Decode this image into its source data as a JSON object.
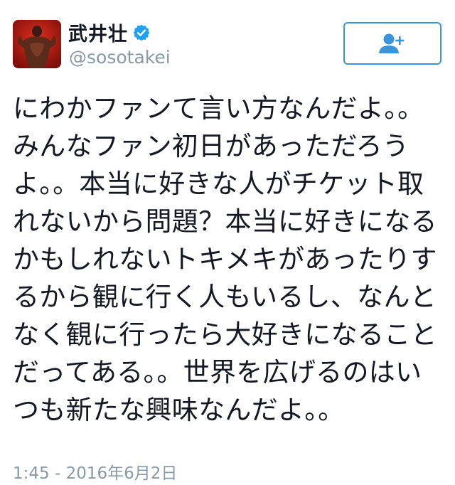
{
  "user": {
    "display_name": "武井壮",
    "handle": "@sosotakei",
    "verified": true
  },
  "follow_button": {
    "icon": "add-user-icon",
    "color": "#3b94d9"
  },
  "tweet": {
    "text": "にわかファンて言い方なんだよ。。\nみんなファン初日があっただろう\nよ。。本当に好きな人がチケット取\nれないから問題？本当に好きになる\nかもしれないトキメキがあったりす\nるから観に行く人もいるし、なんと\nなく観に行ったら大好きになること\nだってある。。世界を広げるのはい\nつも新たな興味なんだよ。。",
    "timestamp": "1:45 - 2016年6月2日"
  },
  "colors": {
    "text": "#141823",
    "muted": "#8899a6",
    "accent": "#3b94d9",
    "verified": "#1da1f2"
  }
}
